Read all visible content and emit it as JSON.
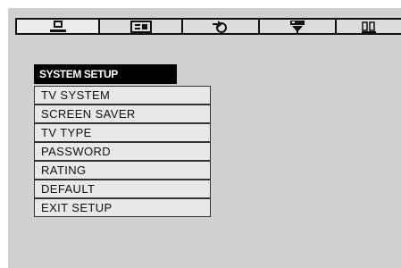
{
  "tabs": [
    {
      "icon": "monitor-icon",
      "active": true
    },
    {
      "icon": "language-icon",
      "active": false
    },
    {
      "icon": "audio-icon",
      "active": false
    },
    {
      "icon": "video-icon",
      "active": false
    },
    {
      "icon": "speaker-icon",
      "active": false
    }
  ],
  "menu": {
    "title": "SYSTEM SETUP",
    "items": [
      {
        "label": "TV SYSTEM"
      },
      {
        "label": "SCREEN SAVER"
      },
      {
        "label": "TV TYPE"
      },
      {
        "label": "PASSWORD"
      },
      {
        "label": "RATING"
      },
      {
        "label": "DEFAULT"
      },
      {
        "label": "EXIT SETUP"
      }
    ]
  }
}
